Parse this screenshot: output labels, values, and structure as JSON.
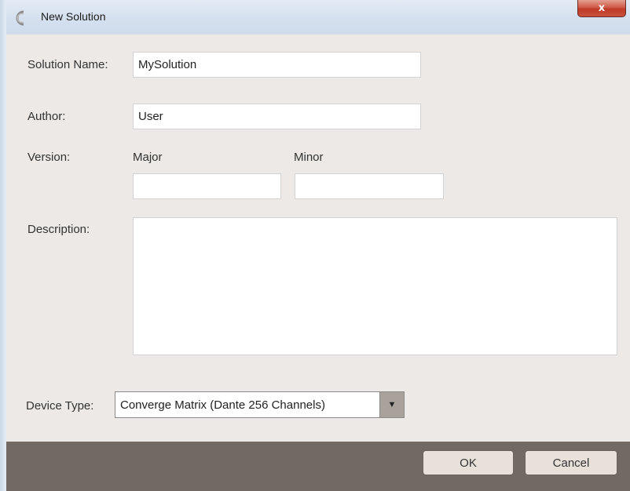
{
  "window": {
    "title": "New Solution",
    "close_label": "x"
  },
  "form": {
    "solution_name": {
      "label": "Solution Name:",
      "value": "MySolution"
    },
    "author": {
      "label": "Author:",
      "value": "User"
    },
    "version": {
      "label": "Version:",
      "major_label": "Major",
      "minor_label": "Minor",
      "major_value": "",
      "minor_value": ""
    },
    "description": {
      "label": "Description:",
      "value": ""
    },
    "device_type": {
      "label": "Device Type:",
      "value": "Converge Matrix (Dante 256 Channels)"
    }
  },
  "footer": {
    "ok_label": "OK",
    "cancel_label": "Cancel"
  }
}
